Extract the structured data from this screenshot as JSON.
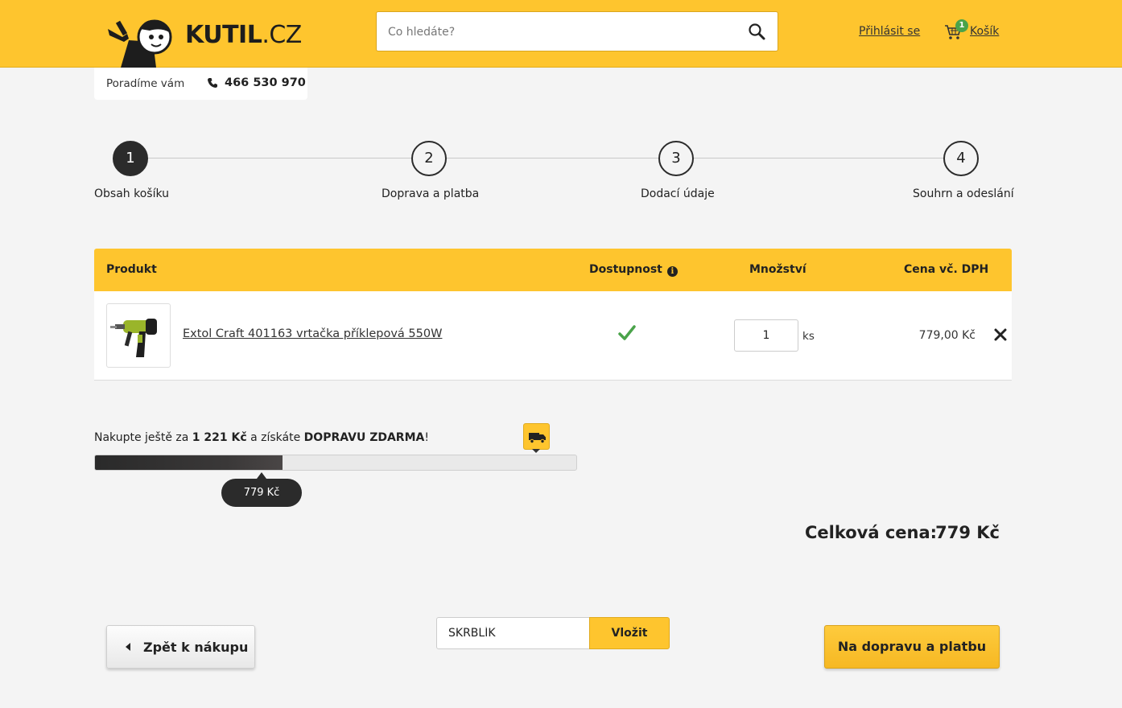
{
  "header": {
    "logo_text": "KUTIL",
    "logo_suffix": ".CZ",
    "search_placeholder": "Co hledáte?",
    "search_value": "",
    "login_label": "Přihlásit se",
    "cart_label": "Košík",
    "cart_count": "1"
  },
  "advice": {
    "label": "Poradíme vám",
    "phone": "466 530 970"
  },
  "steps": [
    {
      "number": "1",
      "label": "Obsah košíku",
      "active": true
    },
    {
      "number": "2",
      "label": "Doprava a platba",
      "active": false
    },
    {
      "number": "3",
      "label": "Dodací údaje",
      "active": false
    },
    {
      "number": "4",
      "label": "Souhrn a odeslání",
      "active": false
    }
  ],
  "table": {
    "headers": {
      "product": "Produkt",
      "availability": "Dostupnost",
      "quantity": "Množství",
      "price": "Cena vč. DPH"
    },
    "rows": [
      {
        "name": "Extol Craft 401163 vrtačka příklepová 550W",
        "available": true,
        "quantity": "1",
        "unit": "ks",
        "price": "779,00 Kč"
      }
    ]
  },
  "shipping": {
    "prefix": "Nakupte ještě za ",
    "remaining": "1 221 Kč",
    "middle": " a získáte ",
    "offer": "DOPRAVU ZDARMA",
    "suffix": "!",
    "current": "779 Kč",
    "progress_fraction": 0.39
  },
  "total": {
    "label": "Celková cena:",
    "value": "779 Kč"
  },
  "actions": {
    "back_label": "Zpět k nákupu",
    "coupon_value": "SKRBLÍK",
    "coupon_button": "Vložit",
    "next_label": "Na dopravu a platbu"
  },
  "colors": {
    "accent": "#fec52e",
    "dark": "#2b2b2b",
    "success": "#4aa34a",
    "background": "#f4f4f4"
  }
}
